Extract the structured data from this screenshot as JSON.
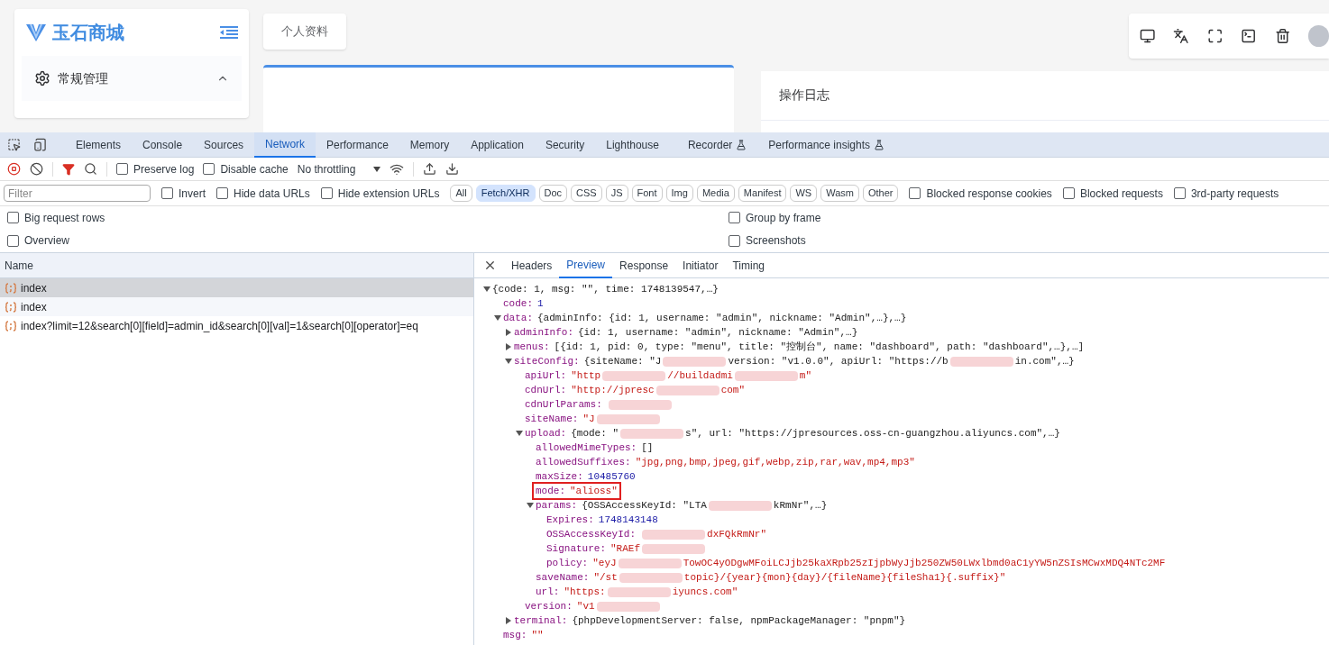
{
  "app": {
    "logo_text": "玉石商城",
    "sidebar_item": {
      "label": "常规管理",
      "expanded": true
    },
    "page_tab": "个人资料",
    "log_card_title": "操作日志"
  },
  "devtools": {
    "panel_tabs": [
      {
        "label": "Elements",
        "selected": false,
        "experimental": false
      },
      {
        "label": "Console",
        "selected": false,
        "experimental": false
      },
      {
        "label": "Sources",
        "selected": false,
        "experimental": false
      },
      {
        "label": "Network",
        "selected": true,
        "experimental": false
      },
      {
        "label": "Performance",
        "selected": false,
        "experimental": false
      },
      {
        "label": "Memory",
        "selected": false,
        "experimental": false
      },
      {
        "label": "Application",
        "selected": false,
        "experimental": false
      },
      {
        "label": "Security",
        "selected": false,
        "experimental": false
      },
      {
        "label": "Lighthouse",
        "selected": false,
        "experimental": false
      },
      {
        "label": "Recorder",
        "selected": false,
        "experimental": true
      },
      {
        "label": "Performance insights",
        "selected": false,
        "experimental": true
      }
    ],
    "toolbar_checkboxes": [
      {
        "label": "Preserve log",
        "checked": false
      },
      {
        "label": "Disable cache",
        "checked": false
      }
    ],
    "throttling": "No throttling",
    "filter": {
      "placeholder": "Filter"
    },
    "filter_checkboxes": [
      {
        "label": "Invert",
        "checked": false
      },
      {
        "label": "Hide data URLs",
        "checked": false
      },
      {
        "label": "Hide extension URLs",
        "checked": false
      }
    ],
    "type_filters": [
      {
        "label": "All",
        "selected": false
      },
      {
        "label": "Fetch/XHR",
        "selected": true
      },
      {
        "label": "Doc",
        "selected": false
      },
      {
        "label": "CSS",
        "selected": false
      },
      {
        "label": "JS",
        "selected": false
      },
      {
        "label": "Font",
        "selected": false
      },
      {
        "label": "Img",
        "selected": false
      },
      {
        "label": "Media",
        "selected": false
      },
      {
        "label": "Manifest",
        "selected": false
      },
      {
        "label": "WS",
        "selected": false
      },
      {
        "label": "Wasm",
        "selected": false
      },
      {
        "label": "Other",
        "selected": false
      }
    ],
    "extra_checkboxes": [
      {
        "label": "Blocked response cookies",
        "checked": false
      },
      {
        "label": "Blocked requests",
        "checked": false
      },
      {
        "label": "3rd-party requests",
        "checked": false
      }
    ],
    "options_left": [
      {
        "label": "Big request rows",
        "checked": false
      },
      {
        "label": "Overview",
        "checked": false
      }
    ],
    "options_right": [
      {
        "label": "Group by frame",
        "checked": false
      },
      {
        "label": "Screenshots",
        "checked": false
      }
    ],
    "requests": {
      "column": "Name",
      "rows": [
        {
          "name": "index",
          "selected": true
        },
        {
          "name": "index",
          "selected": false
        },
        {
          "name": "index?limit=12&search[0][field]=admin_id&search[0][val]=1&search[0][operator]=eq",
          "selected": false
        }
      ]
    },
    "detail_tabs": [
      {
        "label": "Headers",
        "selected": false
      },
      {
        "label": "Preview",
        "selected": true
      },
      {
        "label": "Response",
        "selected": false
      },
      {
        "label": "Initiator",
        "selected": false
      },
      {
        "label": "Timing",
        "selected": false
      }
    ],
    "preview": {
      "expanded": true,
      "parts": [
        {
          "kind": "plain",
          "text": "{code: 1, msg: \"\", time: 1748139547,…}"
        }
      ],
      "children": [
        {
          "key": "code:",
          "parts": [
            {
              "kind": "num",
              "text": "1"
            }
          ]
        },
        {
          "key": "data:",
          "expanded": true,
          "parts": [
            {
              "kind": "plain",
              "text": "{adminInfo: {id: 1, username: \"admin\", nickname: \"Admin\",…},…}"
            }
          ],
          "children": [
            {
              "key": "adminInfo:",
              "expanded": false,
              "parts": [
                {
                  "kind": "plain",
                  "text": "{id: 1, username: \"admin\", nickname: \"Admin\",…}"
                }
              ]
            },
            {
              "key": "menus:",
              "expanded": false,
              "parts": [
                {
                  "kind": "plain",
                  "text": "[{id: 1, pid: 0, type: \"menu\", title: \"控制台\", name: \"dashboard\", path: \"dashboard\",…},…]"
                }
              ]
            },
            {
              "key": "siteConfig:",
              "expanded": true,
              "parts": [
                {
                  "kind": "plain",
                  "text": "{siteName: \"J"
                },
                {
                  "kind": "redacted"
                },
                {
                  "kind": "plain",
                  "text": "version: \"v1.0.0\", apiUrl: \"https://b"
                },
                {
                  "kind": "redacted"
                },
                {
                  "kind": "plain",
                  "text": "in.com\",…}"
                }
              ],
              "children": [
                {
                  "key": "apiUrl:",
                  "parts": [
                    {
                      "kind": "str",
                      "text": "\"http"
                    },
                    {
                      "kind": "redacted"
                    },
                    {
                      "kind": "str",
                      "text": "//buildadmi"
                    },
                    {
                      "kind": "redacted"
                    },
                    {
                      "kind": "str",
                      "text": "m\""
                    }
                  ]
                },
                {
                  "key": "cdnUrl:",
                  "parts": [
                    {
                      "kind": "str",
                      "text": "\"http://jpresc"
                    },
                    {
                      "kind": "redacted"
                    },
                    {
                      "kind": "str",
                      "text": "com\""
                    }
                  ]
                },
                {
                  "key": "cdnUrlParams:",
                  "parts": [
                    {
                      "kind": "redacted"
                    }
                  ]
                },
                {
                  "key": "siteName:",
                  "parts": [
                    {
                      "kind": "str",
                      "text": "\"J"
                    },
                    {
                      "kind": "redacted"
                    }
                  ]
                },
                {
                  "key": "upload:",
                  "expanded": true,
                  "parts": [
                    {
                      "kind": "plain",
                      "text": "{mode: \""
                    },
                    {
                      "kind": "redacted"
                    },
                    {
                      "kind": "plain",
                      "text": "s\", url: \"https://jpresources.oss-cn-guangzhou.aliyuncs.com\",…}"
                    }
                  ],
                  "children": [
                    {
                      "key": "allowedMimeTypes:",
                      "parts": [
                        {
                          "kind": "plain",
                          "text": "[]"
                        }
                      ]
                    },
                    {
                      "key": "allowedSuffixes:",
                      "parts": [
                        {
                          "kind": "str",
                          "text": "\"jpg,png,bmp,jpeg,gif,webp,zip,rar,wav,mp4,mp3\""
                        }
                      ]
                    },
                    {
                      "key": "maxSize:",
                      "parts": [
                        {
                          "kind": "num",
                          "text": "10485760"
                        }
                      ]
                    },
                    {
                      "key": "mode:",
                      "highlighted": true,
                      "parts": [
                        {
                          "kind": "str",
                          "text": "\"alioss\""
                        }
                      ]
                    },
                    {
                      "key": "params:",
                      "expanded": true,
                      "parts": [
                        {
                          "kind": "plain",
                          "text": "{OSSAccessKeyId: \"LTA"
                        },
                        {
                          "kind": "redacted"
                        },
                        {
                          "kind": "plain",
                          "text": "kRmNr\",…}"
                        }
                      ],
                      "children": [
                        {
                          "key": "Expires:",
                          "parts": [
                            {
                              "kind": "num",
                              "text": "1748143148"
                            }
                          ]
                        },
                        {
                          "key": "OSSAccessKeyId:",
                          "parts": [
                            {
                              "kind": "redacted"
                            },
                            {
                              "kind": "str",
                              "text": "dxFQkRmNr\""
                            }
                          ]
                        },
                        {
                          "key": "Signature:",
                          "parts": [
                            {
                              "kind": "str",
                              "text": "\"RAEf"
                            },
                            {
                              "kind": "redacted"
                            }
                          ]
                        },
                        {
                          "key": "policy:",
                          "parts": [
                            {
                              "kind": "str",
                              "text": "\"eyJ"
                            },
                            {
                              "kind": "redacted"
                            },
                            {
                              "kind": "str",
                              "text": "TowOC4yODgwMFoiLCJjb25kaXRpb25zIjpbWyJjb250ZW50LWxlbmd0aC1yYW5nZSIsMCwxMDQ4NTc2MF"
                            }
                          ]
                        }
                      ]
                    },
                    {
                      "key": "saveName:",
                      "parts": [
                        {
                          "kind": "str",
                          "text": "\"/st"
                        },
                        {
                          "kind": "redacted"
                        },
                        {
                          "kind": "str",
                          "text": "topic}/{year}{mon}{day}/{fileName}{fileSha1}{.suffix}\""
                        }
                      ]
                    },
                    {
                      "key": "url:",
                      "parts": [
                        {
                          "kind": "str",
                          "text": "\"https:"
                        },
                        {
                          "kind": "redacted"
                        },
                        {
                          "kind": "str",
                          "text": "iyuncs.com\""
                        }
                      ]
                    }
                  ]
                },
                {
                  "key": "version:",
                  "parts": [
                    {
                      "kind": "str",
                      "text": "\"v1"
                    },
                    {
                      "kind": "redacted"
                    }
                  ]
                }
              ]
            },
            {
              "key": "terminal:",
              "expanded": false,
              "parts": [
                {
                  "kind": "plain",
                  "text": "{phpDevelopmentServer: false, npmPackageManager: \"pnpm\"}"
                }
              ]
            }
          ]
        },
        {
          "key": "msg:",
          "parts": [
            {
              "kind": "str",
              "text": "\"\""
            }
          ]
        }
      ]
    }
  }
}
